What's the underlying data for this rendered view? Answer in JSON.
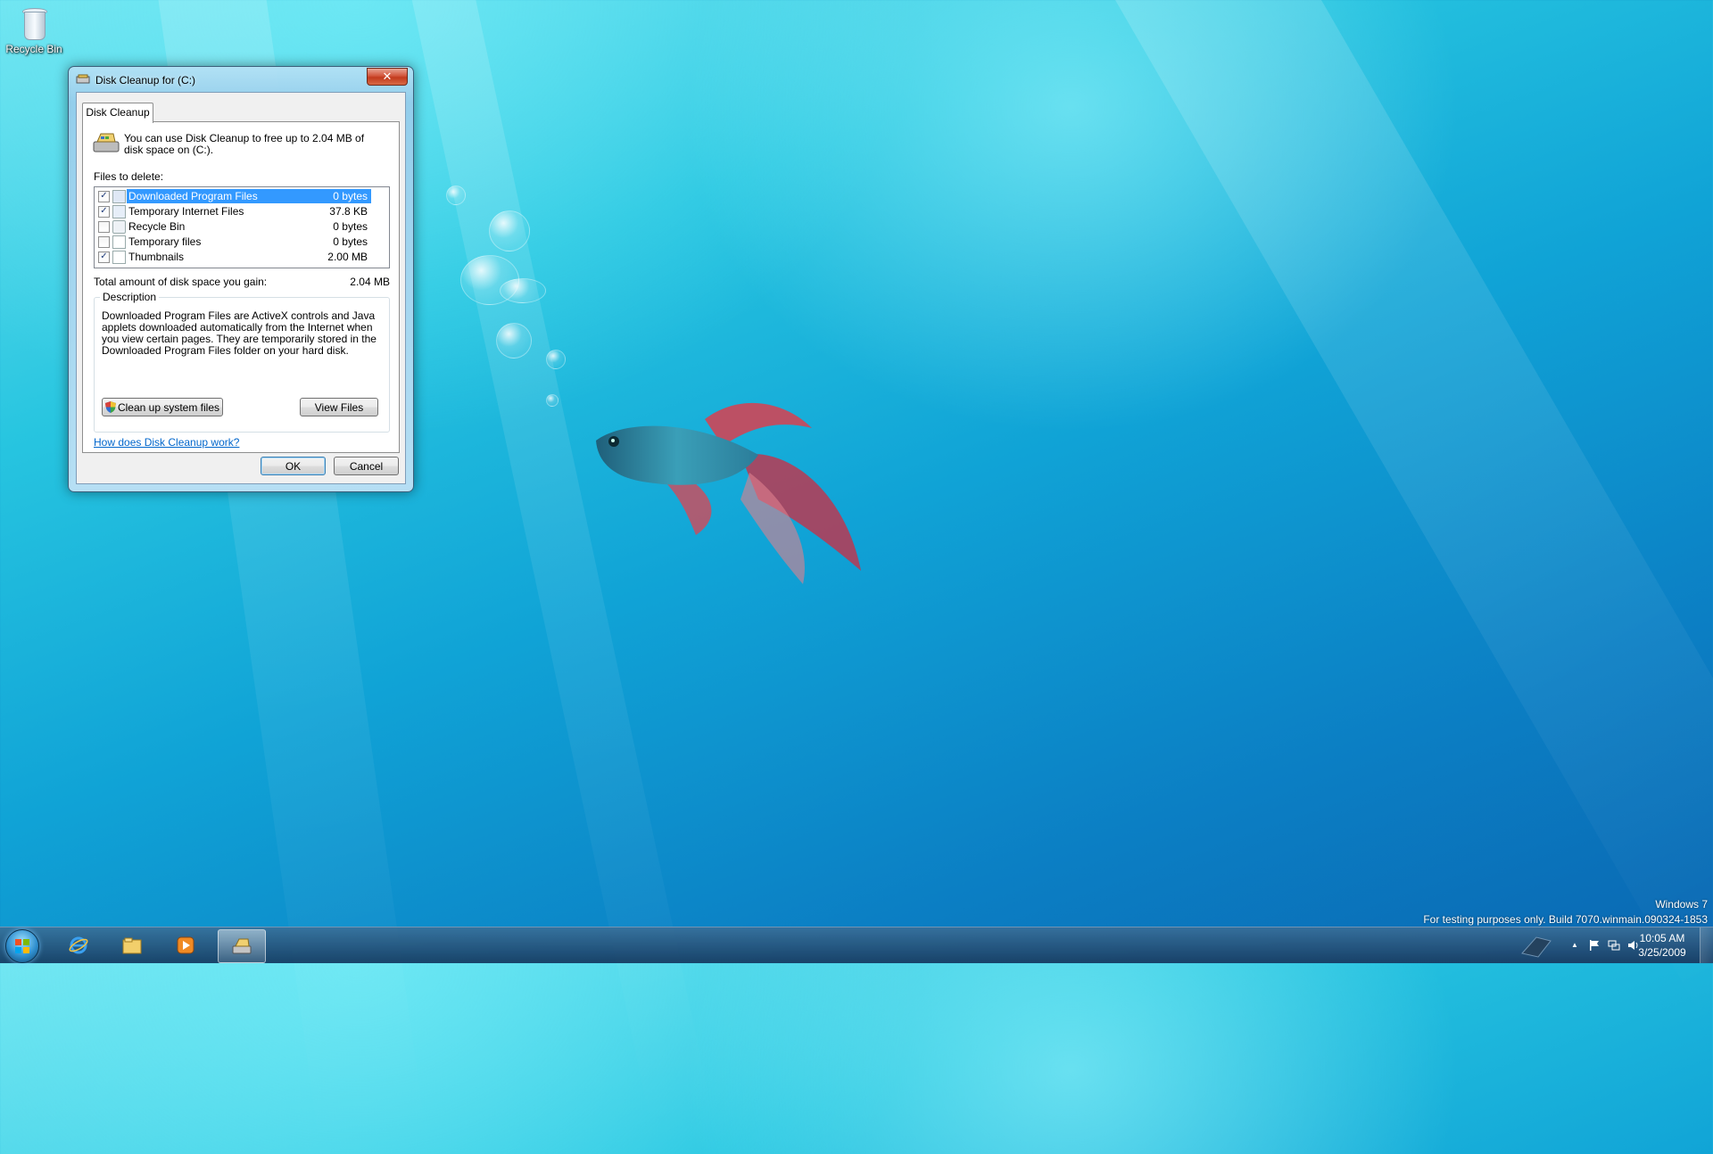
{
  "desktop": {
    "icons": [
      {
        "label": "Recycle Bin",
        "icon": "recycle-bin-icon"
      }
    ],
    "watermark": {
      "line1": "Windows 7",
      "line2": "For testing purposes only. Build 7070.winmain.090324-1853"
    }
  },
  "dialog": {
    "title": "Disk Cleanup for  (C:)",
    "close_label": "✕",
    "tab_label": "Disk Cleanup",
    "intro_text": "You can use Disk Cleanup to free up to 2.04 MB of disk space on  (C:).",
    "files_label": "Files to delete:",
    "files": [
      {
        "name": "Downloaded Program Files",
        "size": "0 bytes",
        "checked": true,
        "selected": true
      },
      {
        "name": "Temporary Internet Files",
        "size": "37.8 KB",
        "checked": true,
        "selected": false
      },
      {
        "name": "Recycle Bin",
        "size": "0 bytes",
        "checked": false,
        "selected": false
      },
      {
        "name": "Temporary files",
        "size": "0 bytes",
        "checked": false,
        "selected": false
      },
      {
        "name": "Thumbnails",
        "size": "2.00 MB",
        "checked": true,
        "selected": false
      }
    ],
    "total_label": "Total amount of disk space you gain:",
    "total_value": "2.04 MB",
    "description_legend": "Description",
    "description_text": "Downloaded Program Files are ActiveX controls and Java applets downloaded automatically from the Internet when you view certain pages. They are temporarily stored in the Downloaded Program Files folder on your hard disk.",
    "clean_system_label": "Clean up system files",
    "view_files_label": "View Files",
    "help_link": "How does Disk Cleanup work?",
    "ok_label": "OK",
    "cancel_label": "Cancel",
    "check_mark": "✓"
  },
  "taskbar": {
    "items": [
      {
        "icon": "internet-explorer-icon",
        "active": false
      },
      {
        "icon": "windows-explorer-icon",
        "active": false
      },
      {
        "icon": "media-player-icon",
        "active": false
      },
      {
        "icon": "disk-cleanup-icon",
        "active": true
      }
    ],
    "tray": {
      "time": "10:05 AM",
      "date": "3/25/2009"
    },
    "show_hidden_glyph": "▲"
  },
  "colors": {
    "selection": "#3399ff",
    "link": "#0066cc",
    "close_button": "#c23a1d"
  }
}
